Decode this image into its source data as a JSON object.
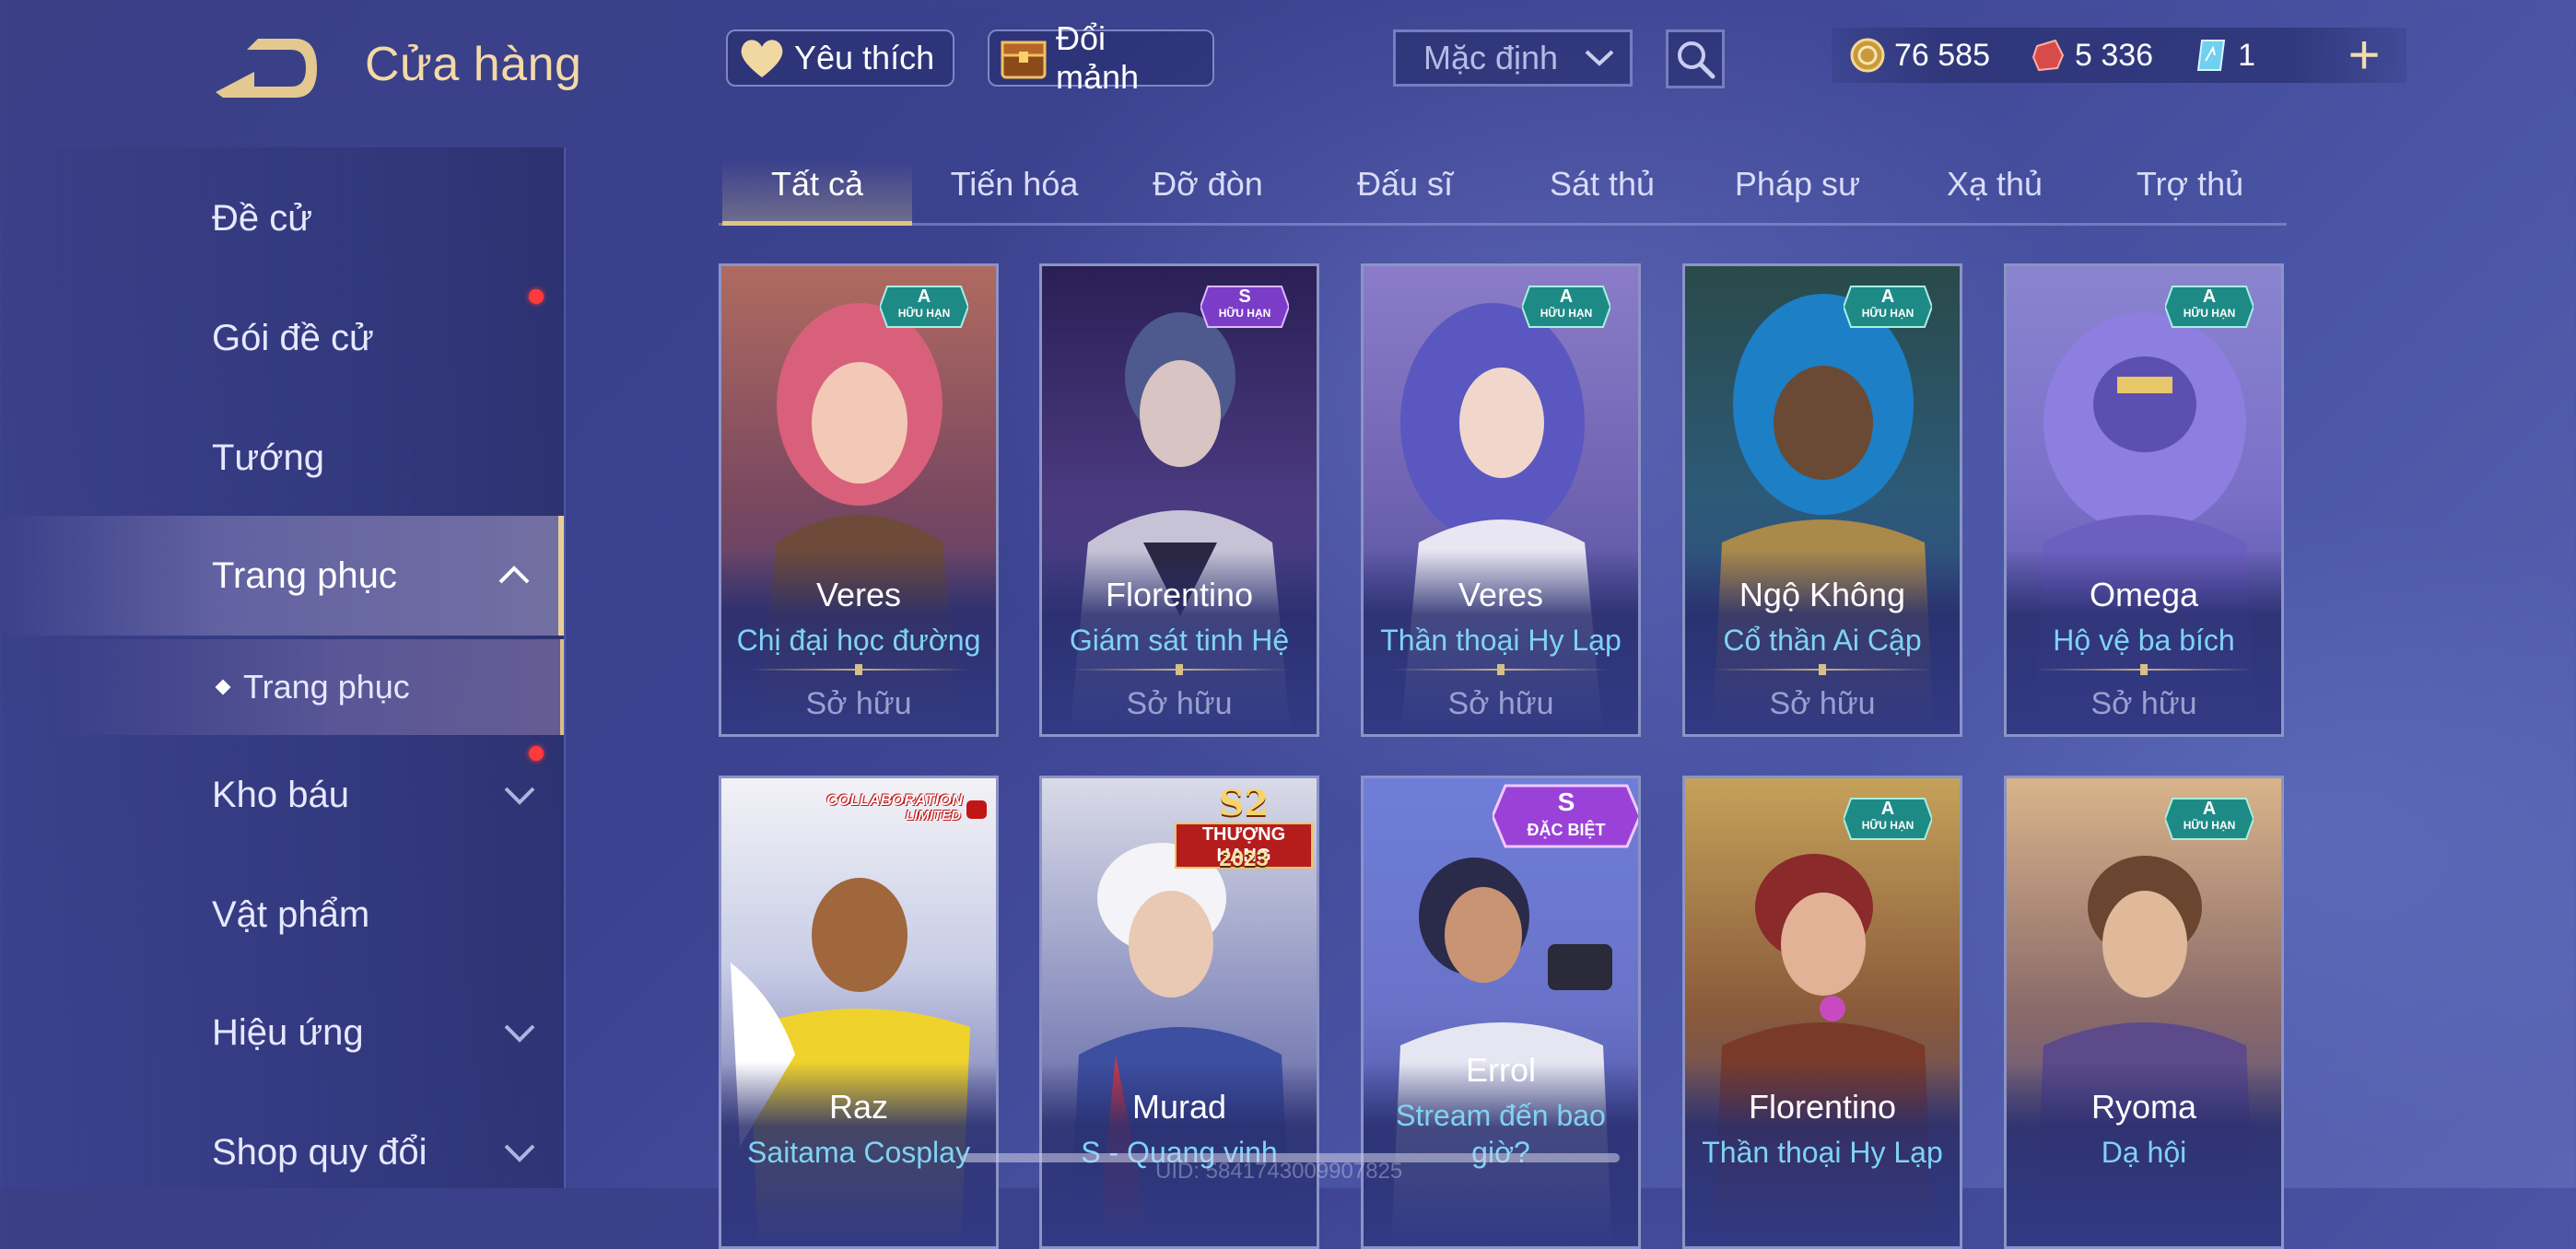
{
  "header": {
    "title": "Cửa hàng",
    "favorites_label": "Yêu thích",
    "exchange_label": "Đổi mảnh",
    "sort_value": "Mặc định",
    "back_icon": "back-arrow-icon",
    "search_icon": "search-icon"
  },
  "currencies": [
    {
      "icon": "gold-coin-icon",
      "value": "76 585"
    },
    {
      "icon": "red-voucher-icon",
      "value": "5 336"
    },
    {
      "icon": "blue-ticket-icon",
      "value": "1"
    }
  ],
  "plus_label": "+",
  "sidebar": {
    "items": [
      {
        "label": "Đề cử"
      },
      {
        "label": "Gói đề cử"
      },
      {
        "label": "Tướng"
      },
      {
        "label": "Trang phục"
      },
      {
        "label": "Trang phục"
      },
      {
        "label": "Kho báu"
      },
      {
        "label": "Vật phẩm"
      },
      {
        "label": "Hiệu ứng"
      },
      {
        "label": "Shop quy đổi"
      }
    ]
  },
  "tabs": [
    "Tất cả",
    "Tiến hóa",
    "Đỡ đòn",
    "Đấu sĩ",
    "Sát thủ",
    "Pháp sư",
    "Xạ thủ",
    "Trợ thủ"
  ],
  "cards": [
    {
      "hero": "Veres",
      "skin": "Chị đại học đường",
      "status": "Sở hữu",
      "badge_grade": "A",
      "badge_text": "HỮU HẠN"
    },
    {
      "hero": "Florentino",
      "skin": "Giám sát tinh Hệ",
      "status": "Sở hữu",
      "badge_grade": "S",
      "badge_text": "HỮU HẠN"
    },
    {
      "hero": "Veres",
      "skin": "Thần thoại Hy Lạp",
      "status": "Sở hữu",
      "badge_grade": "A",
      "badge_text": "HỮU HẠN"
    },
    {
      "hero": "Ngộ Không",
      "skin": "Cổ thần Ai Cập",
      "status": "Sở hữu",
      "badge_grade": "A",
      "badge_text": "HỮU HẠN"
    },
    {
      "hero": "Omega",
      "skin": "Hộ vệ ba bích",
      "status": "Sở hữu",
      "badge_grade": "A",
      "badge_text": "HỮU HẠN"
    },
    {
      "hero": "Raz",
      "skin": "Saitama Cosplay",
      "badge_line1": "COLLABORATION",
      "badge_line2": "LIMITED"
    },
    {
      "hero": "Murad",
      "skin": "S - Quang vinh",
      "badge_line1": "S2",
      "badge_line2": "THƯỢNG HẠNG",
      "badge_line3": "2023"
    },
    {
      "hero": "Errol",
      "skin": "Stream đến bao giờ?",
      "badge_grade": "S",
      "badge_text": "ĐẶC BIỆT"
    },
    {
      "hero": "Florentino",
      "skin": "Thần thoại Hy Lạp",
      "badge_grade": "A",
      "badge_text": "HỮU HẠN"
    },
    {
      "hero": "Ryoma",
      "skin": "Dạ hội",
      "badge_grade": "A",
      "badge_text": "HỮU HẠN"
    }
  ],
  "footer": {
    "uid": "UID: 5841743009907825"
  },
  "colors": {
    "accent_gold": "#e2c582",
    "skin_name_blue": "#7fd3f3",
    "notification_red": "#ff3a3a"
  }
}
